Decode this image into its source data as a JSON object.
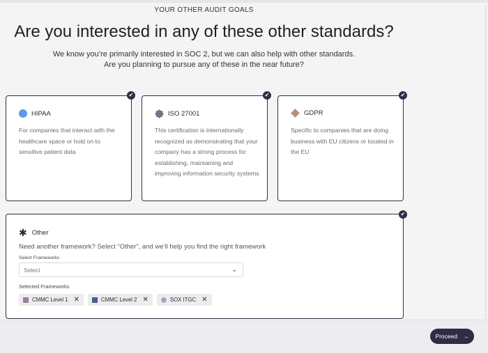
{
  "header": {
    "eyebrow": "YOUR OTHER AUDIT GOALS",
    "title": "Are you interested in any of these other standards?",
    "subtitle_line1": "We know you’re primarily interested in SOC 2, but we can also help with other standards.",
    "subtitle_line2": "Are you planning to pursue any of these in the near future?"
  },
  "cards": [
    {
      "title": "HIPAA",
      "icon": "circle-icon",
      "icon_color": "#5b9ae7",
      "selected": true,
      "description": "For companies that interact with the healthcare space or hold on to sensitive patient data"
    },
    {
      "title": "ISO 27001",
      "icon": "gear-icon",
      "icon_color": "#6d7888",
      "selected": true,
      "description": "This certification is internationally recognized as demonstrating that your company has a strong process for establishing, maintaining and improving information security systems"
    },
    {
      "title": "GDPR",
      "icon": "diamond-icon",
      "icon_color": "#b98e78",
      "selected": true,
      "description": "Specific to companies that are doing business with EU citizens or located in the EU"
    }
  ],
  "other": {
    "title": "Other",
    "selected": true,
    "description": "Need another framework? Select “Other”, and we’ll help you find the right framework",
    "select_label": "Select Frameworks",
    "select_placeholder": "Select",
    "selected_label": "Selected Frameworks",
    "chips": [
      {
        "label": "CMMC Level 1",
        "color": "#9c7e9c"
      },
      {
        "label": "CMMC Level 2",
        "color": "#4b5b8f"
      },
      {
        "label": "SOX ITGC",
        "color": "#a3a0b8"
      }
    ]
  },
  "footer": {
    "proceed_label": "Proceed"
  },
  "colors": {
    "accent": "#2d2e45",
    "card_border": "#2f3044"
  }
}
